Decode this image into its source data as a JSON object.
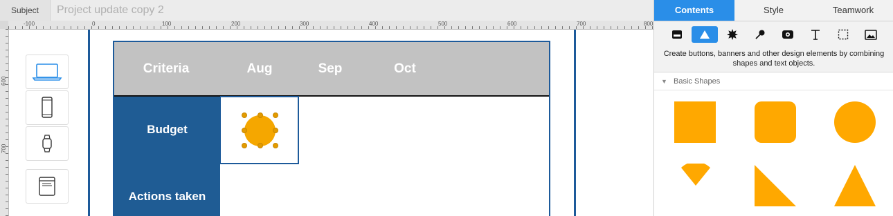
{
  "topbar": {
    "subject_label": "Subject",
    "doc_title": "Project update copy 2"
  },
  "ruler": {
    "h_labels": [
      "-100",
      "0",
      "100",
      "200",
      "300",
      "400",
      "500",
      "600",
      "700",
      "800"
    ],
    "v_labels": [
      "600",
      "700"
    ]
  },
  "devices": [
    {
      "name": "laptop-device-icon",
      "selected": true
    },
    {
      "name": "phone-device-icon",
      "selected": false
    },
    {
      "name": "watch-device-icon",
      "selected": false
    },
    {
      "name": "browser-window-device-icon",
      "selected": false
    }
  ],
  "table": {
    "headers": [
      "Criteria",
      "Aug",
      "Sep",
      "Oct"
    ],
    "rows": [
      "Budget",
      "Actions taken"
    ]
  },
  "colors": {
    "accent": "#2a8ee8",
    "table_header": "#c2c2c2",
    "criteria_col": "#1f5c94",
    "shape_fill": "#ffa800"
  },
  "panel": {
    "tabs": [
      "Contents",
      "Style",
      "Teamwork"
    ],
    "active_tab": "Contents",
    "tools": [
      "panel-icon",
      "shape-triangle-icon",
      "starburst-icon",
      "pin-icon",
      "media-icon",
      "text-icon",
      "selection-box-icon",
      "image-icon"
    ],
    "description": "Create buttons, banners and other design elements by combining shapes and text objects.",
    "section_title": "Basic Shapes",
    "shapes": [
      "square",
      "rounded-square",
      "circle",
      "wedge",
      "right-triangle",
      "triangle"
    ]
  }
}
